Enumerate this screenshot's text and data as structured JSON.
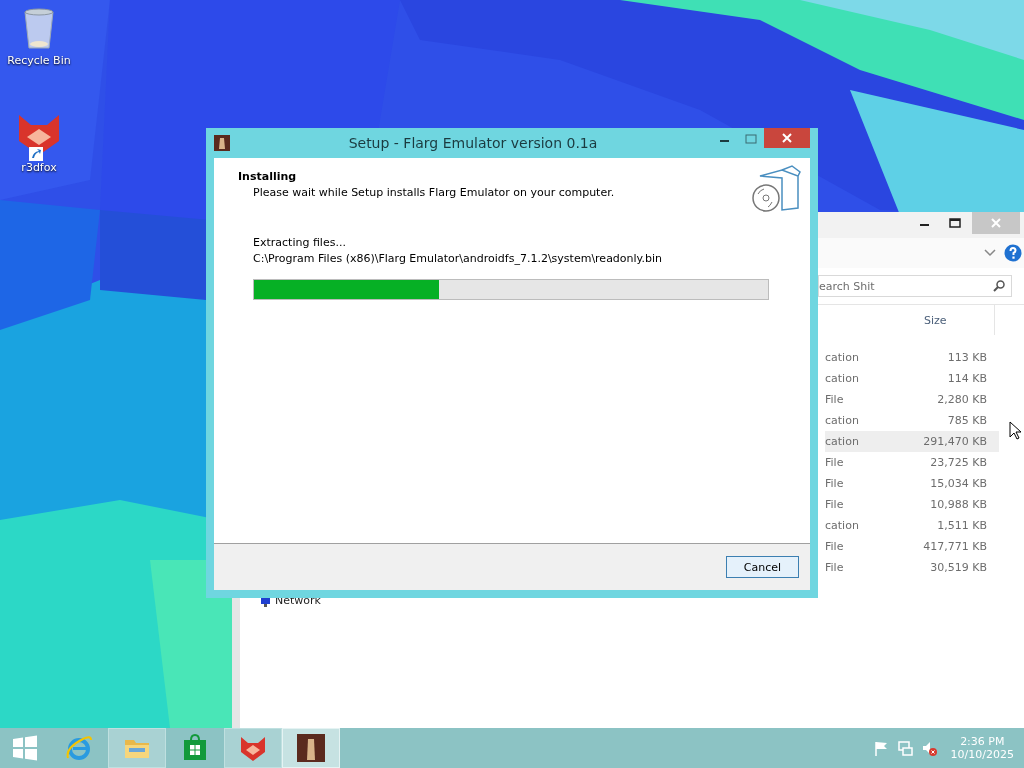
{
  "desktop": {
    "icons": [
      {
        "label": "Recycle Bin",
        "kind": "recycle",
        "shortcut": false
      },
      {
        "label": "r3dfox",
        "kind": "fox",
        "shortcut": true
      }
    ]
  },
  "explorer": {
    "search": {
      "placeholder": "earch Shit"
    },
    "columns": [
      "Size"
    ],
    "rows": [
      {
        "type": "cation",
        "size": "113 KB",
        "selected": false
      },
      {
        "type": "cation",
        "size": "114 KB",
        "selected": false
      },
      {
        "type": "File",
        "size": "2,280 KB",
        "selected": false
      },
      {
        "type": "cation",
        "size": "785 KB",
        "selected": false
      },
      {
        "type": "cation",
        "size": "291,470 KB",
        "selected": true
      },
      {
        "type": "File",
        "size": "23,725 KB",
        "selected": false
      },
      {
        "type": "File",
        "size": "15,034 KB",
        "selected": false
      },
      {
        "type": "File",
        "size": "10,988 KB",
        "selected": false
      },
      {
        "type": "cation",
        "size": "1,511 KB",
        "selected": false
      },
      {
        "type": "File",
        "size": "417,771 KB",
        "selected": false
      },
      {
        "type": "File",
        "size": "30,519 KB",
        "selected": false
      }
    ],
    "nav_items": [
      "Network"
    ]
  },
  "setup": {
    "title": "Setup - Flarg Emulator version 0.1a",
    "heading": "Installing",
    "subheading": "Please wait while Setup installs Flarg Emulator on your computer.",
    "status": "Extracting files...",
    "path": "C:\\Program Files (x86)\\Flarg Emulator\\androidfs_7.1.2\\system\\readonly.bin",
    "progress": {
      "level": 0.36
    },
    "buttons": [
      "Cancel"
    ]
  },
  "taskbar": {
    "apps": [
      {
        "kind": "ie",
        "running": false,
        "selected": false
      },
      {
        "kind": "explorer",
        "running": true,
        "selected": false
      },
      {
        "kind": "store",
        "running": false,
        "selected": false
      },
      {
        "kind": "fox",
        "running": true,
        "selected": false
      },
      {
        "kind": "setup",
        "running": true,
        "selected": true
      }
    ],
    "tray": [
      {
        "kind": "flag"
      },
      {
        "kind": "network"
      },
      {
        "kind": "volume-muted"
      }
    ],
    "clock": {
      "time": "2:36 PM",
      "date": "10/10/2025"
    }
  }
}
